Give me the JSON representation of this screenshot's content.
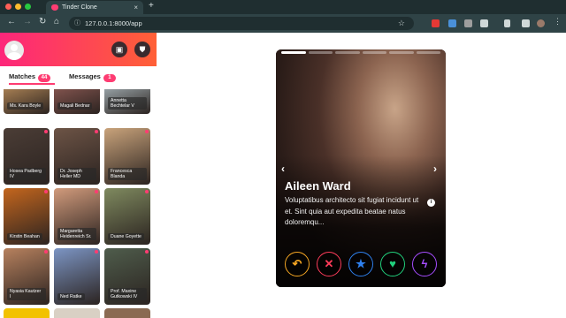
{
  "browser": {
    "tab_title": "Tinder Clone",
    "tab_close": "×",
    "new_tab": "+",
    "url": "127.0.0.1:8000/app",
    "window_dots": [
      "#ff5f57",
      "#febc2e",
      "#28c840"
    ],
    "nav_icons": {
      "back": "←",
      "forward": "→",
      "reload": "↻",
      "home": "⌂",
      "bookmark": "☆",
      "site_info": "ⓘ"
    }
  },
  "sidebar": {
    "tabs": [
      {
        "label": "Matches",
        "badge": "44",
        "active": true
      },
      {
        "label": "Messages",
        "badge": "1",
        "active": false
      }
    ],
    "header_icons": [
      "briefcase-icon",
      "shield-icon"
    ],
    "matches": [
      {
        "name": "Ms. Kara Boyle",
        "color": "#b98c5a"
      },
      {
        "name": "Magali Bednar",
        "color": "#8e5a54"
      },
      {
        "name": "Annetta Bechtelar V",
        "color": "#a7b4b9"
      },
      {
        "name": "Hosea Padberg IV",
        "color": "#4b3d36"
      },
      {
        "name": "Dr. Joseph Heller MD",
        "color": "#6d5446"
      },
      {
        "name": "Francesca Blanda",
        "color": "#c9a37b"
      },
      {
        "name": "Kirstin Beahan",
        "color": "#c4661e"
      },
      {
        "name": "Margaretta Heidenreich Sr.",
        "color": "#d29b7c"
      },
      {
        "name": "Duane Goyette",
        "color": "#7f8a5f"
      },
      {
        "name": "Nyasia Kautzer I",
        "color": "#b7815e"
      },
      {
        "name": "Ned Ratke",
        "color": "#7c95c4"
      },
      {
        "name": "Prof. Maxine Gutkowski IV",
        "color": "#4f5d4c"
      }
    ]
  },
  "profile": {
    "name": "Aileen Ward",
    "bio": "Voluptatibus architecto sit fugiat incidunt ut et. Sint quia aut expedita beatae natus doloremqu...",
    "info_icon": "i",
    "prev_arrow": "‹",
    "next_arrow": "›",
    "photo_count": 6,
    "current_photo": 1,
    "actions": [
      {
        "name": "rewind",
        "symbol": "↶",
        "color": "#f5a623"
      },
      {
        "name": "nope",
        "symbol": "✕",
        "color": "#fd3c5a"
      },
      {
        "name": "super-like",
        "symbol": "★",
        "color": "#2f80ed"
      },
      {
        "name": "like",
        "symbol": "♥",
        "color": "#21d07c"
      },
      {
        "name": "boost",
        "symbol": "ϟ",
        "color": "#a64dff"
      }
    ]
  },
  "colors": {
    "brand": "#fe3c72",
    "brand_gradient_end": "#ff6036"
  }
}
